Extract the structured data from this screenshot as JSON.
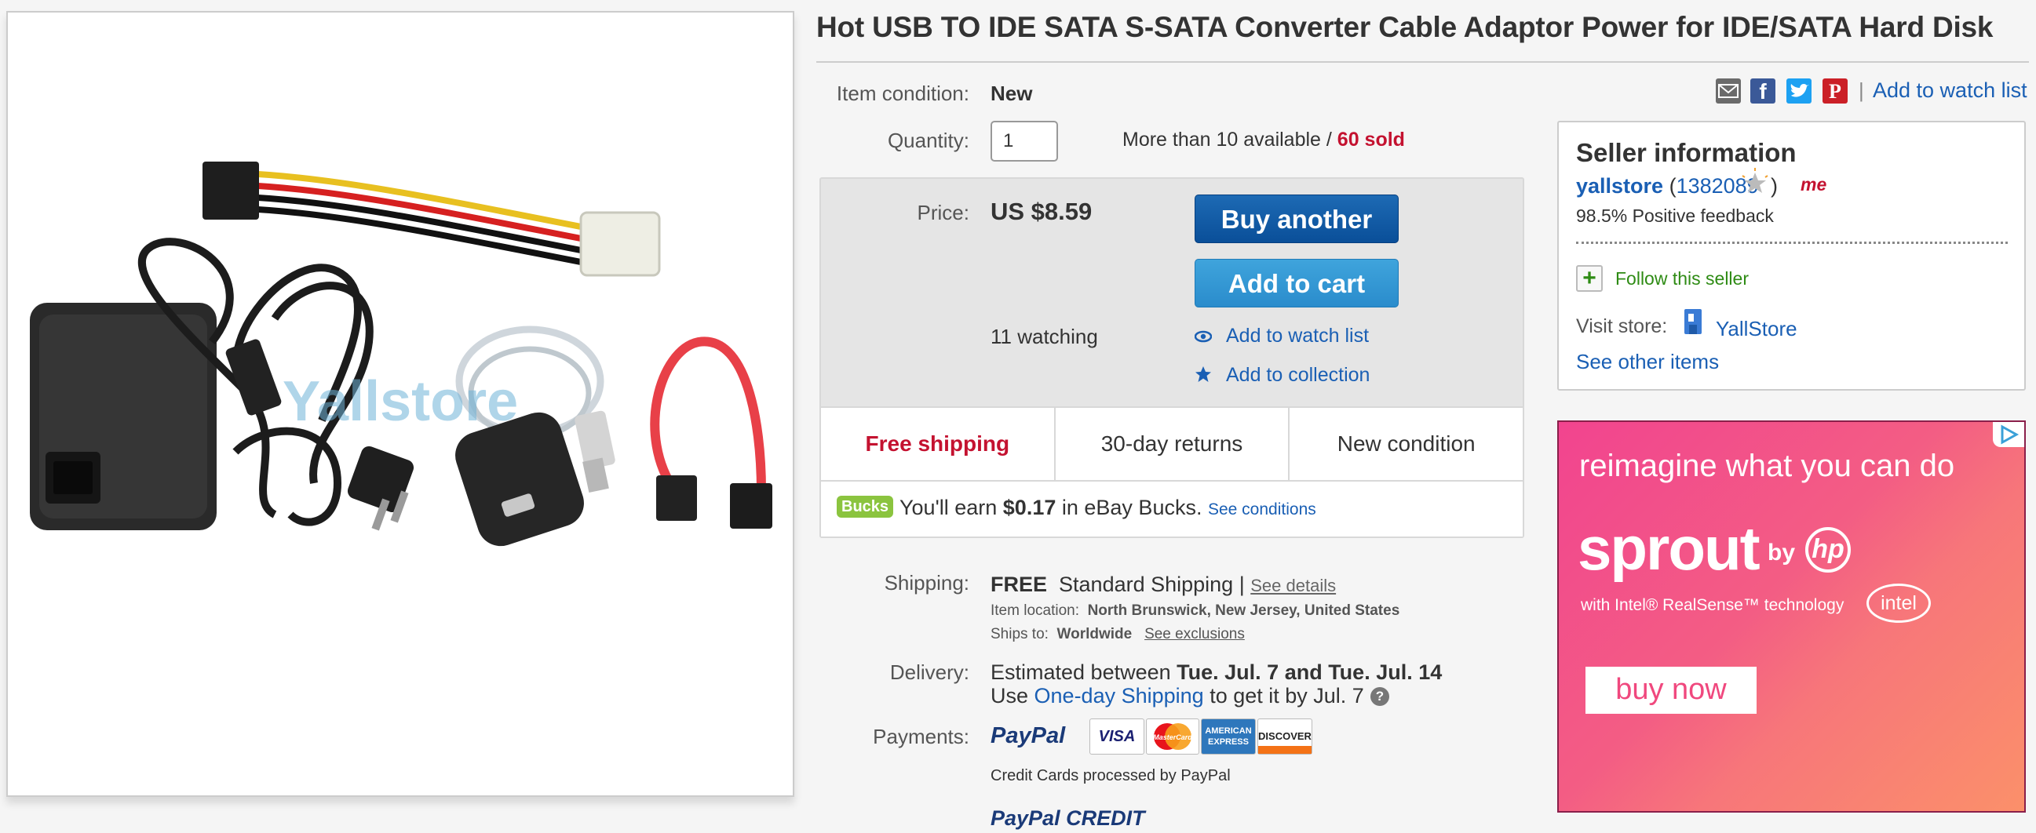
{
  "product": {
    "title": "Hot USB TO IDE SATA S-SATA Converter Cable Adaptor Power for IDE/SATA Hard Disk",
    "watermark": "Yallstore"
  },
  "condition": {
    "label": "Item condition:",
    "value": "New"
  },
  "share": {
    "separator": "|",
    "watch_label": "Add to watch list"
  },
  "quantity": {
    "label": "Quantity:",
    "value": "1",
    "availability": "More than 10 available /",
    "sold": "60 sold"
  },
  "price": {
    "label": "Price:",
    "value": "US $8.59",
    "watching": "11 watching",
    "buy_label": "Buy another",
    "cart_label": "Add to cart",
    "watch_link": "Add to watch list",
    "collection_link": "Add to collection"
  },
  "features": {
    "shipping": "Free shipping",
    "returns": "30-day returns",
    "condition": "New condition"
  },
  "bucks": {
    "badge": "Bucks",
    "text_pre": "You'll earn",
    "amount": "$0.17",
    "text_post": "in eBay Bucks.",
    "link": "See conditions"
  },
  "shipping": {
    "label": "Shipping:",
    "free": "FREE",
    "method": "Standard Shipping",
    "separator": "|",
    "details_link": "See details",
    "location_label": "Item location:",
    "location_value": "North Brunswick, New Jersey, United States",
    "ships_label": "Ships to:",
    "ships_value": "Worldwide",
    "exclusions_link": "See exclusions"
  },
  "delivery": {
    "label": "Delivery:",
    "estimated_pre": "Estimated between",
    "estimated_dates": "Tue. Jul. 7 and Tue. Jul. 14",
    "use": "Use",
    "one_day_link": "One-day Shipping",
    "get_by": "to get it by Jul. 7",
    "help": "?"
  },
  "payments": {
    "label": "Payments:",
    "paypal": "PayPal",
    "cards": [
      "VISA",
      "MasterCard",
      "AMERICAN EXPRESS",
      "DISCOVER"
    ],
    "note": "Credit Cards processed by PayPal",
    "credit": "PayPal CREDIT"
  },
  "seller": {
    "heading": "Seller information",
    "name": "yallstore",
    "open_paren": "(",
    "score": "1382089",
    "close_paren": ")",
    "me_badge": "me",
    "feedback": "98.5% Positive feedback",
    "follow": "Follow this seller",
    "visit_label": "Visit store:",
    "store_name": "YallStore",
    "other_items": "See other items"
  },
  "ad": {
    "tagline": "reimagine what you can do",
    "brand": "sprout",
    "by": "by",
    "hp": "hp",
    "tech": "with Intel® RealSense™ technology",
    "intel": "intel",
    "cta": "buy now"
  },
  "colors": {
    "link": "#1a5fb4",
    "sold_red": "#c41230",
    "buy_button": "#0a4f99",
    "cart_button": "#2a8ccc",
    "follow_green": "#2e8b14",
    "ad_pink": "#f2448f"
  }
}
